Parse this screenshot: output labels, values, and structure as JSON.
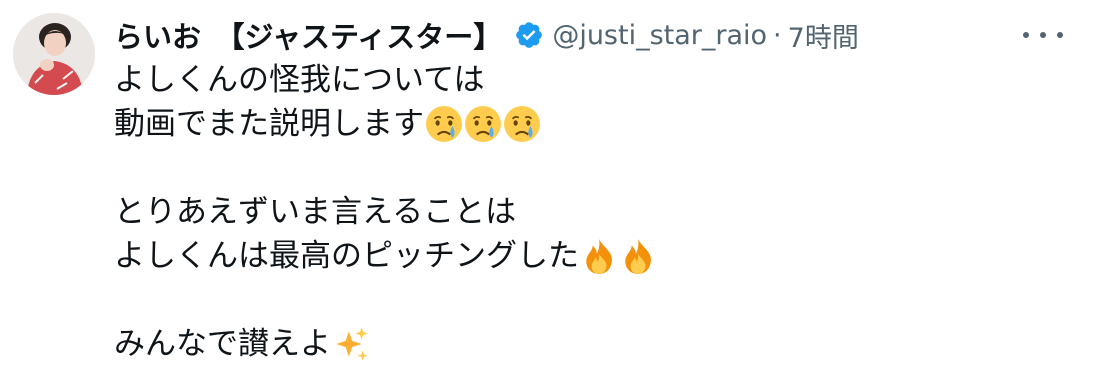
{
  "user": {
    "display_name": "らいお　【ジャスティスター】",
    "handle": "@justi_star_raio",
    "separator": "·",
    "time": "7時間"
  },
  "tweet": {
    "lines": [
      "よしくんの怪我については",
      "動画でまた説明します",
      "",
      "とりあえずいま言えることは",
      "よしくんは最高のピッチングした",
      "",
      "みんなで讃えよ"
    ],
    "emoji": {
      "line2": [
        "crying-face-emoji",
        "crying-face-emoji",
        "crying-face-emoji"
      ],
      "line5": [
        "fire-emoji",
        "fire-emoji"
      ],
      "line7": [
        "sparkles-emoji"
      ]
    }
  },
  "colors": {
    "text": "#0f1419",
    "muted": "#536471",
    "verified": "#1d9bf0"
  }
}
